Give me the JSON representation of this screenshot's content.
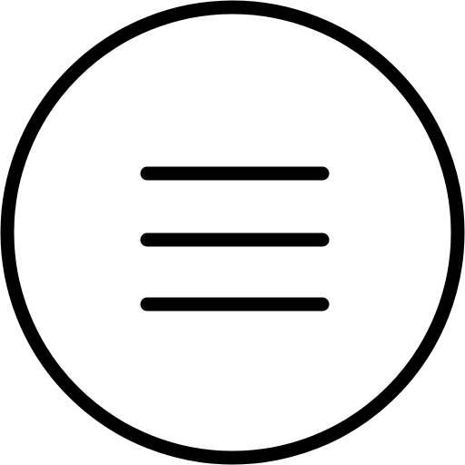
{
  "icon": {
    "name": "hamburger-menu-icon",
    "stroke_color": "#000000",
    "fill_color": "#ffffff"
  }
}
